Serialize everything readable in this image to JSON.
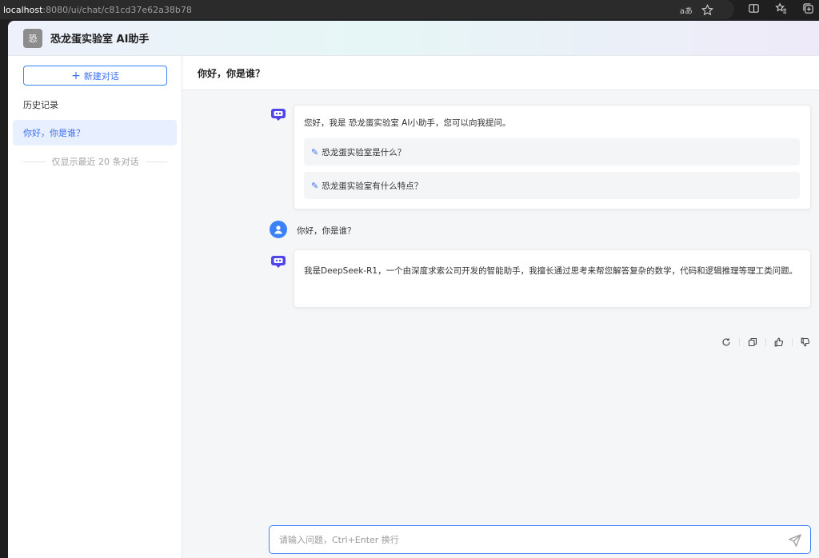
{
  "browser": {
    "url_host": "localhost",
    "url_path": ":8080/ui/chat/c81cd37e62a38b78",
    "read_aloud": "aあ"
  },
  "app": {
    "logo_char": "恐",
    "title": "恐龙蛋实验室 AI助手"
  },
  "sidebar": {
    "new_chat_label": "新建对话",
    "history_label": "历史记录",
    "history_items": [
      {
        "label": "你好，你是谁？"
      }
    ],
    "history_note": "仅显示最近 20 条对话"
  },
  "chat": {
    "title": "你好，你是谁？",
    "welcome_text": "您好，我是 恐龙蛋实验室 AI小助手，您可以向我提问。",
    "suggestions": [
      "恐龙蛋实验室是什么？",
      "恐龙蛋实验室有什么特点？"
    ],
    "user_message": "你好，你是谁？",
    "bot_reply": "我是DeepSeek-R1，一个由深度求索公司开发的智能助手，我擅长通过思考来帮您解答复杂的数学，代码和逻辑推理等理工类问题。",
    "actions": [
      "refresh-icon",
      "copy-icon",
      "thumbs-up-icon",
      "thumbs-down-icon"
    ]
  },
  "input": {
    "placeholder": "请输入问题，Ctrl+Enter 换行",
    "value": ""
  },
  "colors": {
    "accent": "#3b82f6",
    "link": "#3b6ff0",
    "selected_bg": "#e8f0ff"
  }
}
